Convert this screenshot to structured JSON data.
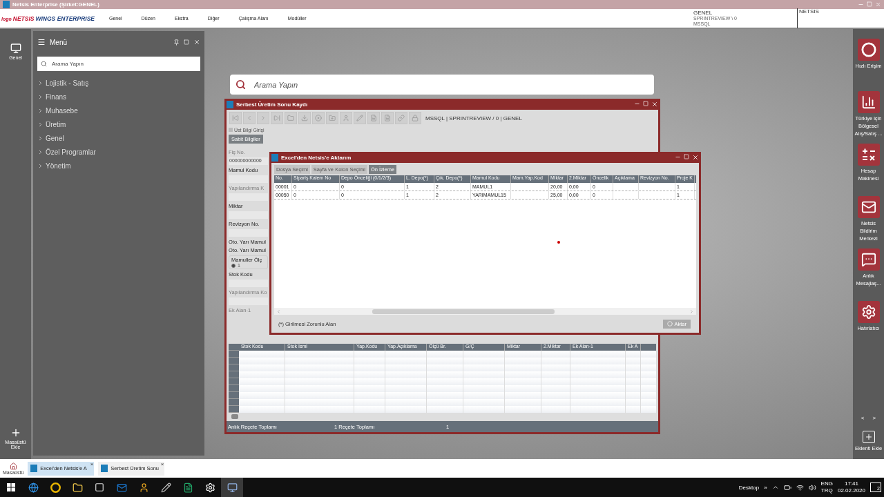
{
  "window": {
    "title": "Netsis Enterprise (Şirket:GENEL)"
  },
  "app_bar": {
    "logo": {
      "prefix": "logo",
      "brand": "NETSIS",
      "rest": "WINGS ENTERPRISE"
    },
    "menu": [
      "Genel",
      "Düzen",
      "Ekstra",
      "Diğer",
      "Çalışma Alanı",
      "Modüller"
    ],
    "company": "GENEL",
    "database": "SPRINTREVIEW \\ 0",
    "server": "MSSQL",
    "user": "NETSIS"
  },
  "left_bar": {
    "top": "Genel",
    "bottom": "Masaüstü Ekle"
  },
  "menu_panel": {
    "title": "Menü",
    "search": {
      "placeholder": "Arama Yapın"
    },
    "items": [
      "Lojistik - Satış",
      "Finans",
      "Muhasebe",
      "Üretim",
      "Genel",
      "Özel Programlar",
      "Yönetim"
    ]
  },
  "search": {
    "placeholder": "Arama Yapın"
  },
  "production_window": {
    "title": "Serbest Üretim Sonu Kaydı",
    "connection": "MSSQL | SPRINTREVIEW / 0 | GENEL",
    "header_toggle": {
      "label": "Üst Bilgi Girişi",
      "checked": false
    },
    "fixed_button": "Sabit Bilgiler",
    "form": [
      {
        "kind": "label",
        "text": "Fiş No.",
        "disabled": true
      },
      {
        "kind": "field",
        "value": "000000000000"
      },
      {
        "kind": "label",
        "text": "Mamul Kodu",
        "disabled": false
      },
      {
        "kind": "field"
      },
      {
        "kind": "label",
        "text": "Yapılandırma K",
        "disabled": true
      },
      {
        "kind": "field"
      },
      {
        "kind": "label",
        "text": "Miktar",
        "disabled": false
      },
      {
        "kind": "field"
      },
      {
        "kind": "label",
        "text": "Revizyon No.",
        "disabled": false
      },
      {
        "kind": "field"
      },
      {
        "kind": "label",
        "text": "Oto. Yarı Mamul",
        "disabled": false
      },
      {
        "kind": "label",
        "text": "Oto. Yarı Mamul",
        "disabled": false
      },
      {
        "kind": "group",
        "text": "Mamuller Ölç",
        "option": {
          "label": "1",
          "selected": true
        }
      },
      {
        "kind": "label",
        "text": "Stok Kodu",
        "disabled": false
      },
      {
        "kind": "field"
      },
      {
        "kind": "label",
        "text": "Yapılandırma Ko",
        "disabled": true
      },
      {
        "kind": "field"
      },
      {
        "kind": "label",
        "text": "Ek Alan-1",
        "disabled": true
      }
    ],
    "grid": {
      "columns": [
        "Stok Kodu",
        "Stok İsmi",
        "Yap.Kodu",
        "Yap.Açıklama",
        "Ölçü Br.",
        "G/Ç",
        "Miktar",
        "2.Miktar",
        "Ek Alan-1",
        "Ek A"
      ]
    },
    "status": [
      "Anlık Reçete Toplamı",
      "1 Reçete Toplamı",
      "1"
    ]
  },
  "import_dialog": {
    "title": "Excel'den Netsis'e Aktarım",
    "tabs": [
      {
        "label": "Dosya Seçimi",
        "selected": false
      },
      {
        "label": "Sayfa ve Kolon Seçimi",
        "selected": false
      },
      {
        "label": "Ön İzleme",
        "selected": true
      }
    ],
    "columns": [
      "No.",
      "Sipariş Kalem No",
      "Depo Önceliği (0/1/2/3)",
      "L. Depo(*)",
      "Çık. Depo(*)",
      "Mamul Kodu",
      "Mam.Yap.Kod",
      "Miktar",
      "2.Miktar",
      "Öncelik",
      "Açıklama",
      "Revizyon No.",
      "Proje K"
    ],
    "rows": [
      [
        "00001",
        "0",
        "0",
        "1",
        "2",
        "MAMUL1",
        "",
        "20,00",
        "0,00",
        "0",
        "",
        "",
        "1"
      ],
      [
        "00050",
        "0",
        "0",
        "1",
        "2",
        "YARIMAMUL15",
        "",
        "25,00",
        "0,00",
        "0",
        "",
        "",
        "1"
      ]
    ],
    "note": "(*) Girilmesi Zorunlu Alan",
    "action": {
      "label": "Aktar",
      "disabled": true
    }
  },
  "right_bar": {
    "items": [
      {
        "kind": "ring",
        "label": "Hızlı Erişim"
      },
      {
        "kind": "chart",
        "label": "Türkiye için Bölgesel Alış/Satış ..."
      },
      {
        "kind": "calc",
        "label": "Hesap Makinesi"
      },
      {
        "kind": "mail",
        "label": "Netsis Bildirim Merkezi"
      },
      {
        "kind": "chat",
        "label": "Anlık Mesajlaş..."
      },
      {
        "kind": "gear",
        "label": "Hatırlatıcı"
      }
    ],
    "prev": "<",
    "next": ">",
    "add": "Eklenti Ekle"
  },
  "dock": {
    "home": "Masaüstü",
    "tabs": [
      {
        "label": "Excel'den Netsis'e A",
        "selected": true,
        "close": "×"
      },
      {
        "label": "Serbest Üretim Sonu",
        "selected": false,
        "close": "×"
      }
    ]
  },
  "taskbar": {
    "desktop": "Desktop",
    "overflow": "»",
    "lang1": "ENG",
    "lang2": "TRQ",
    "time": "17:41",
    "date": "02.02.2020",
    "notifications": "2"
  }
}
